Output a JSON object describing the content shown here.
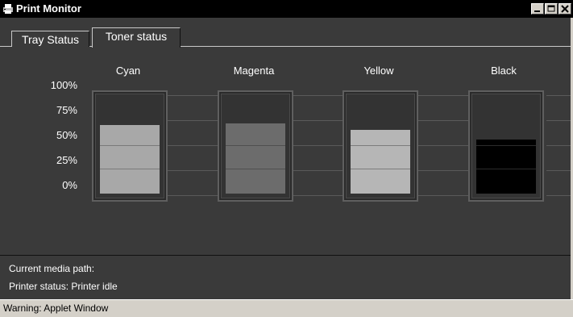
{
  "window": {
    "title": "Print Monitor",
    "icon": "printer-icon",
    "buttons": [
      "minimize-icon",
      "maximize-icon",
      "close-icon"
    ]
  },
  "tabs": [
    {
      "label": "Tray Status",
      "active": false
    },
    {
      "label": "Toner status",
      "active": true
    }
  ],
  "scale_labels": [
    "100%",
    "75%",
    "50%",
    "25%",
    "0%"
  ],
  "toner": [
    {
      "name": "Cyan",
      "level": 0.72,
      "fill": "#a8a8a8",
      "seg": "#7a7a7a"
    },
    {
      "name": "Magenta",
      "level": 0.74,
      "fill": "#6c6c6c",
      "seg": "#4f4f4f"
    },
    {
      "name": "Yellow",
      "level": 0.67,
      "fill": "#b6b6b6",
      "seg": "#7c7c7c"
    },
    {
      "name": "Black",
      "level": 0.57,
      "fill": "#000000",
      "seg": "#2c2c2c"
    }
  ],
  "status": {
    "media_path": "Current media path:",
    "printer_status": "Printer status: Printer idle"
  },
  "warning": "Warning: Applet Window",
  "colors": {
    "background": "#3a3a3a",
    "titlebar": "#000000",
    "warning_bar": "#d4d0c8"
  }
}
